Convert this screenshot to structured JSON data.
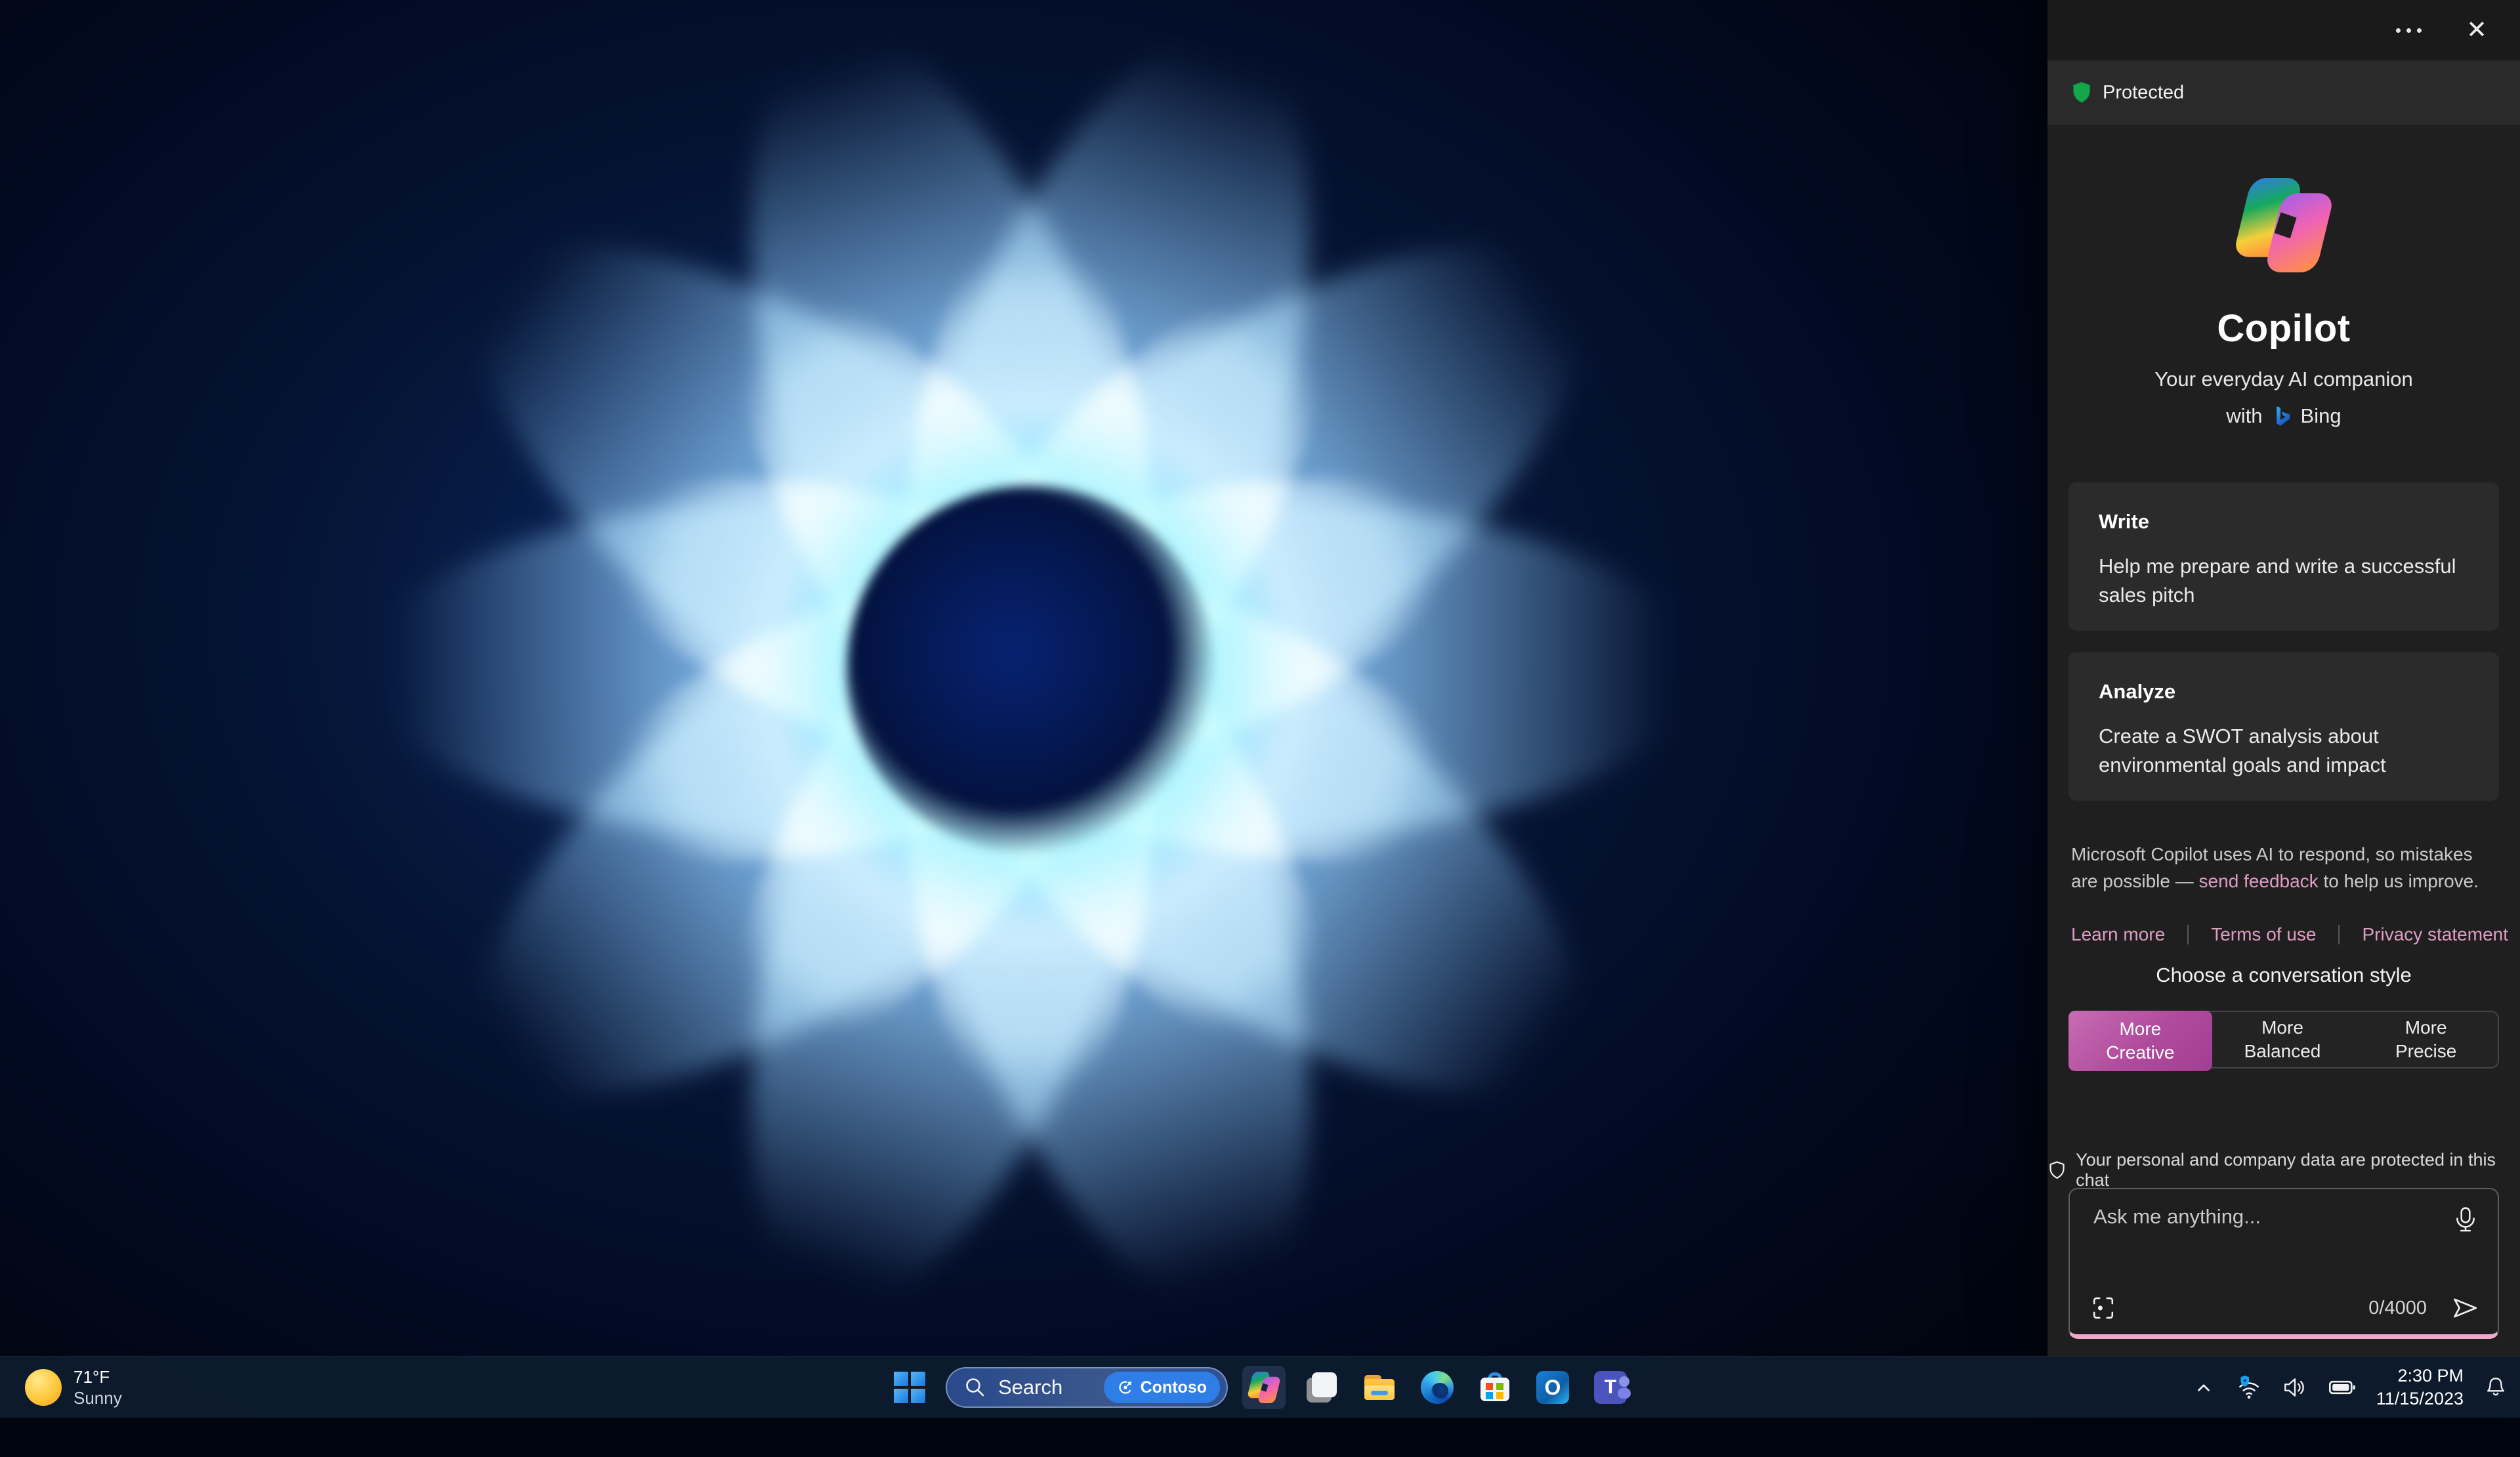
{
  "colors": {
    "accent_pink": "#e09cc4",
    "creative_gradient": [
      "#c86cb4",
      "#a23e93"
    ],
    "protected_green": "#17a54a",
    "panel_bg": "#1f1f1f",
    "taskbar_bg": "#0d1b2e"
  },
  "window": {
    "close_glyph": "✕"
  },
  "copilot_panel": {
    "protected_label": "Protected",
    "title": "Copilot",
    "subtitle": "Your everyday AI companion",
    "with_label": "with",
    "bing_label": "Bing",
    "cards": [
      {
        "heading": "Write",
        "body": "Help me prepare and write a successful sales pitch"
      },
      {
        "heading": "Analyze",
        "body": "Create a SWOT analysis about environmental goals and impact"
      }
    ],
    "disclaimer": {
      "prefix": "Microsoft Copilot uses AI to respond, so mistakes are possible — ",
      "link": "send feedback",
      "suffix": " to help us improve."
    },
    "links": {
      "learn_more": "Learn more",
      "terms": "Terms of use",
      "privacy": "Privacy statement"
    },
    "style_chooser": {
      "label": "Choose a conversation style",
      "options": [
        {
          "line1": "More",
          "line2": "Creative",
          "selected": true
        },
        {
          "line1": "More",
          "line2": "Balanced",
          "selected": false
        },
        {
          "line1": "More",
          "line2": "Precise",
          "selected": false
        }
      ]
    },
    "privacy_note": "Your personal and company data are protected in this chat",
    "input": {
      "placeholder": "Ask me anything...",
      "counter": "0/4000"
    }
  },
  "taskbar": {
    "weather": {
      "temperature": "71°F",
      "condition": "Sunny"
    },
    "search": {
      "label": "Search",
      "badge": "Contoso"
    },
    "app_icons": [
      "start",
      "search",
      "copilot",
      "task-view",
      "file-explorer",
      "edge",
      "microsoft-store",
      "outlook",
      "teams"
    ],
    "tray_icons": [
      "chevron-up",
      "wifi-vpn-shield",
      "volume",
      "battery",
      "bell"
    ],
    "clock": {
      "time": "2:30 PM",
      "date": "11/15/2023"
    }
  }
}
